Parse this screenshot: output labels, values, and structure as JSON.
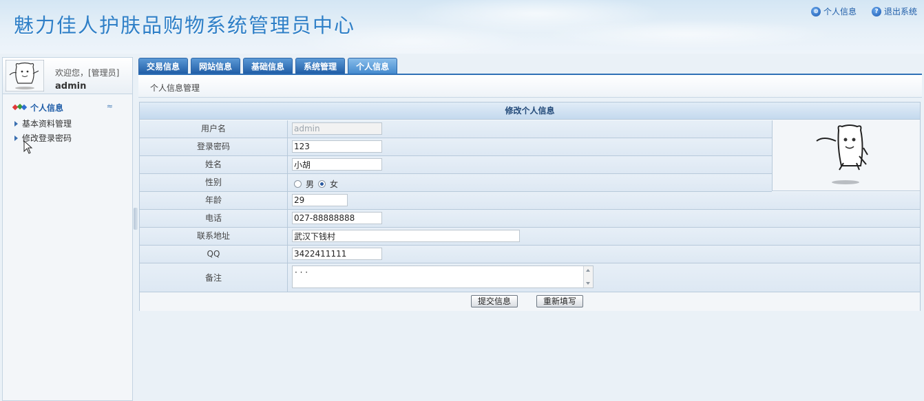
{
  "header": {
    "title": "魅力佳人护肤品购物系统管理员中心",
    "links": [
      {
        "label": "个人信息",
        "icon": "user-icon",
        "glyph": "⊗"
      },
      {
        "label": "退出系统",
        "icon": "help-icon",
        "glyph": "?"
      }
    ]
  },
  "sidebar": {
    "welcome": "欢迎您，[管理员]",
    "username": "admin",
    "menu_title": "个人信息",
    "collapse_glyph": "≈",
    "items": [
      {
        "label": "基本资料管理"
      },
      {
        "label": "修改登录密码"
      }
    ]
  },
  "tabs": [
    {
      "label": "交易信息"
    },
    {
      "label": "网站信息"
    },
    {
      "label": "基础信息"
    },
    {
      "label": "系统管理"
    },
    {
      "label": "个人信息",
      "active": true
    }
  ],
  "breadcrumb": "个人信息管理",
  "form": {
    "title": "修改个人信息",
    "fields": {
      "username": {
        "label": "用户名",
        "value": "admin"
      },
      "password": {
        "label": "登录密码",
        "value": "123"
      },
      "name": {
        "label": "姓名",
        "value": "小胡"
      },
      "gender": {
        "label": "性别",
        "options": [
          "男",
          "女"
        ],
        "selected": "女"
      },
      "age": {
        "label": "年龄",
        "value": "29"
      },
      "phone": {
        "label": "电话",
        "value": "027-88888888"
      },
      "address": {
        "label": "联系地址",
        "value": "武汉下钱村"
      },
      "qq": {
        "label": "QQ",
        "value": "3422411111"
      },
      "remark": {
        "label": "备注",
        "value": "· · ·"
      }
    },
    "submit_label": "提交信息",
    "reset_label": "重新填写"
  },
  "colors": {
    "title": "#2e7fc7",
    "tab": "#1e5ba4",
    "tab_active": "#3f86cc",
    "link": "#1f5da8"
  }
}
